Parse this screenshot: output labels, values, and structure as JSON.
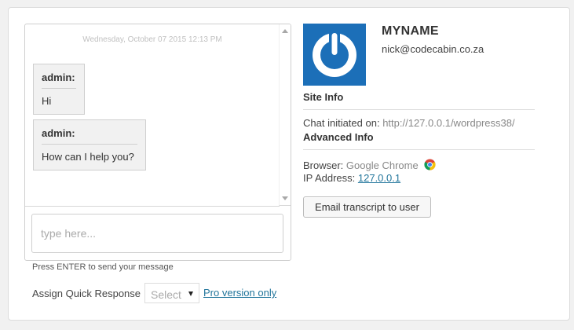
{
  "chat": {
    "timestamp": "Wednesday, October 07 2015 12:13 PM",
    "messages": [
      {
        "name": "admin:",
        "text": "Hi"
      },
      {
        "name": "admin:",
        "text": "How can I help you?"
      }
    ],
    "input_placeholder": "type here...",
    "enter_hint": "Press ENTER to send your message"
  },
  "quick_response": {
    "label": "Assign Quick Response",
    "select_value": "Select",
    "pro_link": "Pro version only"
  },
  "visitor": {
    "name": "MYNAME",
    "email": "nick@codecabin.co.za",
    "avatar_icon": "power-icon",
    "avatar_color": "#1c6fb8"
  },
  "site_info": {
    "title": "Site Info",
    "chat_initiated_label": "Chat initiated on:",
    "chat_initiated_url": "http://127.0.0.1/wordpress38/"
  },
  "advanced_info": {
    "title": "Advanced Info",
    "browser_label": "Browser:",
    "browser_value": "Google Chrome",
    "browser_icon": "chrome-icon",
    "ip_label": "IP Address:",
    "ip_value": "127.0.0.1"
  },
  "actions": {
    "email_transcript": "Email transcript to user"
  }
}
